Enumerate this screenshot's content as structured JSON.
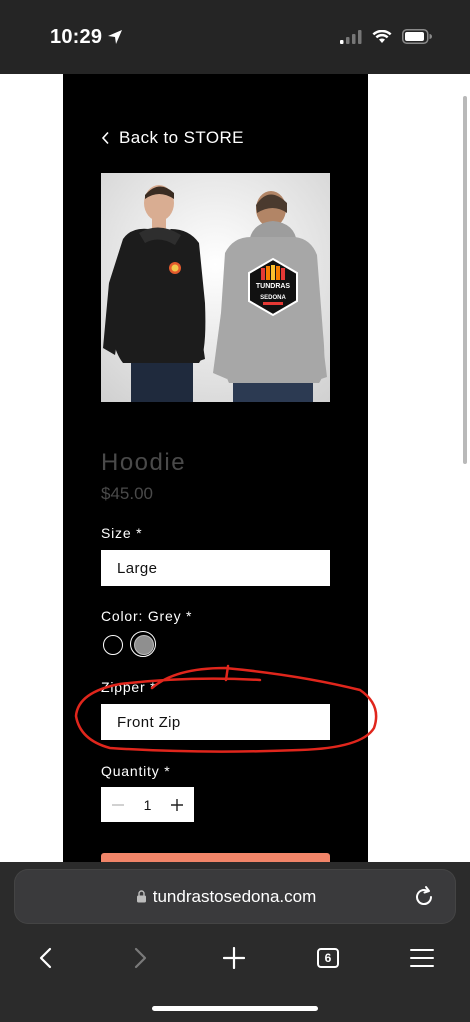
{
  "status_bar": {
    "time": "10:29",
    "icons": [
      "location-arrow-icon",
      "signal-icon",
      "wifi-icon",
      "battery-icon"
    ]
  },
  "product": {
    "back_link": "Back to STORE",
    "image_alt": "Two models wearing black and grey hoodies with Tundras Sedona logo",
    "logo_text_top": "TUNDRAS",
    "logo_text_bottom": "SEDONA",
    "title": "Hoodie",
    "price": "$45.00",
    "size_label": "Size *",
    "size_value": "Large",
    "color_label": "Color: Grey *",
    "colors": [
      {
        "name": "Black",
        "hex": "#000000",
        "selected": false
      },
      {
        "name": "Grey",
        "hex": "#8f8f8f",
        "selected": true
      }
    ],
    "zipper_label": "Zipper *",
    "zipper_value": "Front Zip",
    "quantity_label": "Quantity *",
    "quantity_value": "1",
    "add_button_color": "#f08468"
  },
  "browser": {
    "url": "tundrastosedona.com",
    "tab_count": "6"
  },
  "colors": {
    "panel_bg": "#000000",
    "status_bg": "#252525",
    "browser_bg": "#2b2b2b",
    "annotation": "#e0261c"
  }
}
